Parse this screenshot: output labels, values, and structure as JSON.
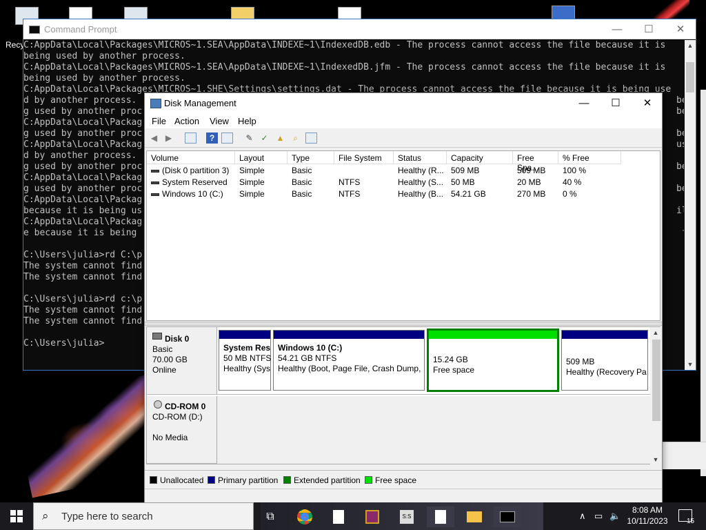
{
  "desktop": {
    "recycle_label": "Recyc"
  },
  "cmd": {
    "title": "Command Prompt",
    "lines": [
      "C:AppData\\Local\\Packages\\MICROS~1.SEA\\AppData\\INDEXE~1\\IndexedDB.edb - The process cannot access the file because it is",
      "being used by another process.",
      "C:AppData\\Local\\Packages\\MICROS~1.SEA\\AppData\\INDEXE~1\\IndexedDB.jfm - The process cannot access the file because it is",
      "being used by another process.",
      "C:AppData\\Local\\Packages\\MICROS~1.SHE\\Settings\\settings.dat - The process cannot access the file because it is being use",
      "d by another process.                                                                                                    bein",
      "g used by another proc                                                                                                   bein",
      "C:AppData\\Local\\Packag",
      "g used by another proc                                                                                                   bein",
      "C:AppData\\Local\\Packag                                                                                                   use",
      "d by another process.",
      "g used by another proc                                                                                                   bein",
      "C:AppData\\Local\\Packag",
      "g used by another proc                                                                                                   bein",
      "C:AppData\\Local\\Packag",
      "because it is being us                                                                                                   ile",
      "C:AppData\\Local\\Packag",
      "e because it is being                                                                                                     fil",
      "",
      "C:\\Users\\julia>rd C:\\p",
      "The system cannot find",
      "The system cannot find",
      "",
      "C:\\Users\\julia>rd c:\\p",
      "The system cannot find",
      "The system cannot find",
      "",
      "C:\\Users\\julia>"
    ]
  },
  "dm": {
    "title": "Disk Management",
    "menu": [
      "File",
      "Action",
      "View",
      "Help"
    ],
    "columns": [
      "Volume",
      "Layout",
      "Type",
      "File System",
      "Status",
      "Capacity",
      "Free Spa...",
      "% Free"
    ],
    "volumes": [
      {
        "volume": "(Disk 0 partition 3)",
        "layout": "Simple",
        "type": "Basic",
        "fs": "",
        "status": "Healthy (R...",
        "capacity": "509 MB",
        "free": "509 MB",
        "pct": "100 %"
      },
      {
        "volume": "System Reserved",
        "layout": "Simple",
        "type": "Basic",
        "fs": "NTFS",
        "status": "Healthy (S...",
        "capacity": "50 MB",
        "free": "20 MB",
        "pct": "40 %"
      },
      {
        "volume": "Windows 10 (C:)",
        "layout": "Simple",
        "type": "Basic",
        "fs": "NTFS",
        "status": "Healthy (B...",
        "capacity": "54.21 GB",
        "free": "270 MB",
        "pct": "0 %"
      }
    ],
    "disk0": {
      "name": "Disk 0",
      "type": "Basic",
      "size": "70.00 GB",
      "state": "Online"
    },
    "partitions": [
      {
        "title": "System Res",
        "size": "50 MB NTFS",
        "status": "Healthy (Sys"
      },
      {
        "title": "Windows 10  (C:)",
        "size": "54.21 GB NTFS",
        "status": "Healthy (Boot, Page File, Crash Dump, I"
      },
      {
        "title": "",
        "size": "15.24 GB",
        "status": "Free space"
      },
      {
        "title": "",
        "size": "509 MB",
        "status": "Healthy (Recovery Pa"
      }
    ],
    "cdrom": {
      "name": "CD-ROM 0",
      "type": "CD-ROM (D:)",
      "media": "No Media"
    },
    "legend": [
      "Unallocated",
      "Primary partition",
      "Extended partition",
      "Free space"
    ],
    "colors": {
      "unallocated": "#000000",
      "primary": "#000080",
      "extended": "#008000",
      "free": "#00e000"
    }
  },
  "taskbar": {
    "search_placeholder": "Type here to search",
    "time": "8:08 AM",
    "date": "10/11/2023",
    "notification_count": "15"
  }
}
